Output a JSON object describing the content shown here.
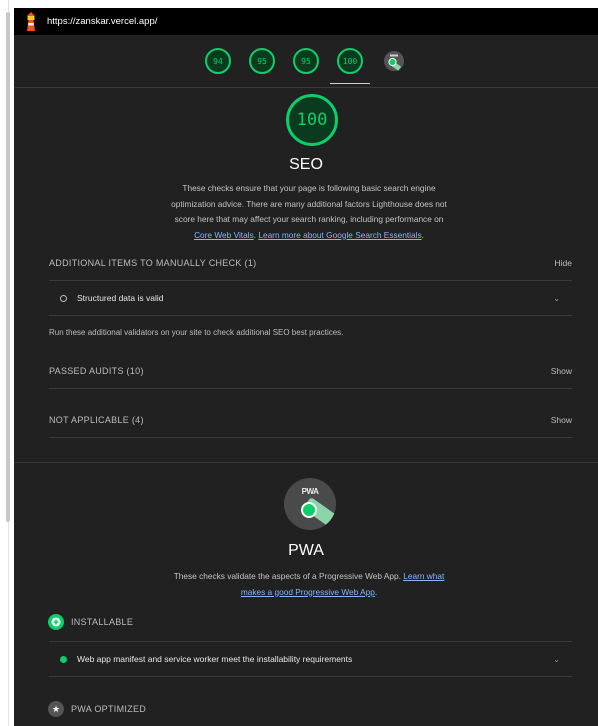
{
  "browser": {
    "url": "https://zanskar.vercel.app/"
  },
  "score_gauges": [
    {
      "value": "94"
    },
    {
      "value": "95"
    },
    {
      "value": "95"
    },
    {
      "value": "100"
    }
  ],
  "seo": {
    "score": "100",
    "title": "SEO",
    "description_line1": "These checks ensure that your page is following basic search engine",
    "description_line2": "optimization advice. There are many additional factors Lighthouse does not",
    "description_line3": "score here that may affect your search ranking, including performance on",
    "link_core_web_vitals": "Core Web Vitals",
    "link_learn_more": "Learn more about Google Search Essentials",
    "manual_group_title": "ADDITIONAL ITEMS TO MANUALLY CHECK (1)",
    "manual_toggle": "Hide",
    "manual_audit": "Structured data is valid",
    "manual_note": "Run these additional validators on your site to check additional SEO best practices.",
    "passed_title": "PASSED AUDITS (10)",
    "passed_toggle": "Show",
    "na_title": "NOT APPLICABLE (4)",
    "na_toggle": "Show"
  },
  "pwa": {
    "badge_text": "PWA",
    "title": "PWA",
    "description": "These checks validate the aspects of a Progressive Web App.",
    "link_part1": "Learn what",
    "link_part2": "makes a good Progressive Web App",
    "installable_title": "INSTALLABLE",
    "installable_audit": "Web app manifest and service worker meet the installability requirements",
    "optimized_title": "PWA OPTIMIZED"
  },
  "colors": {
    "pass": "#0cce6b",
    "background": "#212121"
  }
}
